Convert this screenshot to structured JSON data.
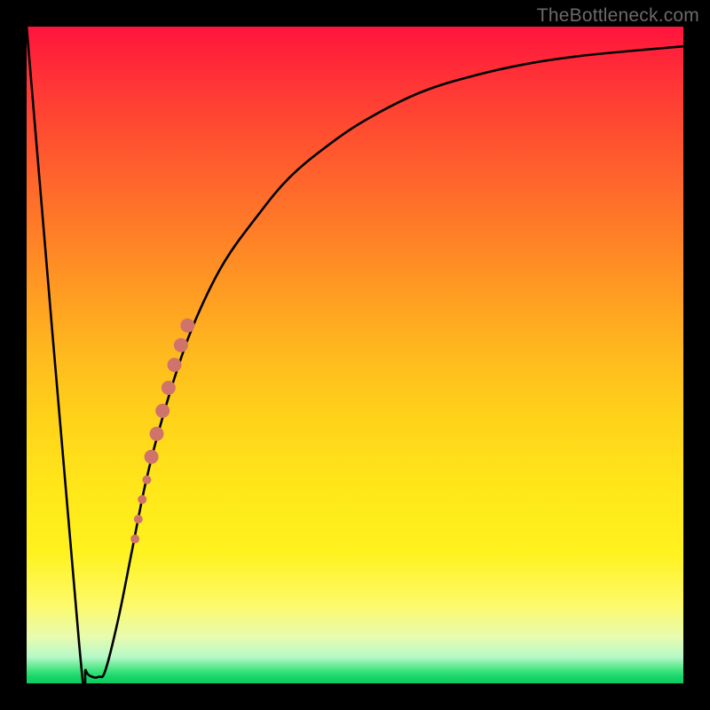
{
  "watermark": "TheBottleneck.com",
  "colors": {
    "curve_stroke": "#000000",
    "marker_fill": "#d0736a",
    "frame_bg": "#000000"
  },
  "chart_data": {
    "type": "line",
    "title": "",
    "xlabel": "",
    "ylabel": "",
    "xlim": [
      0,
      100
    ],
    "ylim": [
      0,
      100
    ],
    "grid": false,
    "legend": false,
    "series": [
      {
        "name": "bottleneck-curve",
        "x": [
          0,
          8,
          9,
          10,
          11,
          12,
          14,
          16,
          18,
          20,
          23,
          26,
          30,
          35,
          40,
          46,
          52,
          60,
          68,
          76,
          84,
          92,
          100
        ],
        "values": [
          100,
          6,
          2,
          1,
          1,
          2,
          10,
          20,
          30,
          38,
          48,
          56,
          64,
          71,
          77,
          82,
          86,
          90,
          92.5,
          94.3,
          95.5,
          96.3,
          97
        ]
      }
    ],
    "markers": {
      "name": "highlighted-points",
      "x": [
        16.5,
        17.0,
        17.6,
        18.3,
        19.0,
        19.8,
        20.7,
        21.6,
        22.5,
        23.5,
        24.5
      ],
      "values": [
        22.0,
        25.0,
        28.0,
        31.0,
        34.5,
        38.0,
        41.5,
        45.0,
        48.5,
        51.5,
        54.5
      ],
      "radius": [
        5,
        5,
        5,
        5,
        8,
        8,
        8,
        8,
        8,
        8,
        8
      ]
    }
  }
}
